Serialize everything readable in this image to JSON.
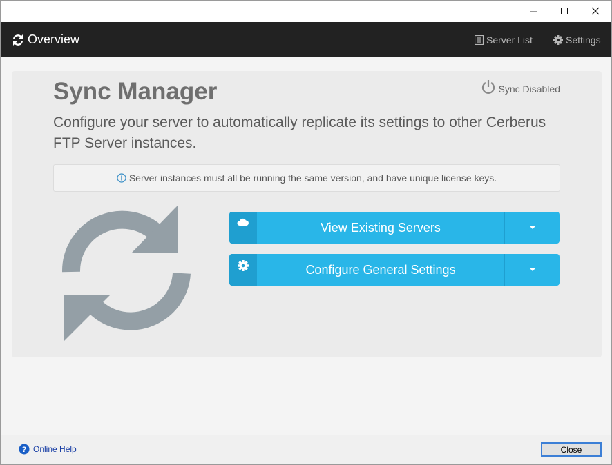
{
  "window": {
    "controls": [
      "minimize-icon",
      "maximize-icon",
      "close-icon"
    ]
  },
  "navbar": {
    "brand_label": "Overview",
    "brand_icon": "refresh-icon",
    "server_list_label": "Server List",
    "server_list_icon": "list-icon",
    "settings_label": "Settings",
    "settings_icon": "gear-icon"
  },
  "main": {
    "title": "Sync Manager",
    "sync_status_label": "Sync Disabled",
    "sync_status_icon": "power-icon",
    "description": "Configure your server to automatically replicate its settings to other Cerberus FTP Server instances.",
    "info_text": "Server instances must all be running the same version, and have unique license keys.",
    "info_icon": "info-circle-icon",
    "hero_icon": "sync-icon",
    "buttons": [
      {
        "label": "View Existing Servers",
        "icon": "cloud-icon"
      },
      {
        "label": "Configure General Settings",
        "icon": "gear-icon"
      }
    ]
  },
  "footer": {
    "help_label": "Online Help",
    "help_icon": "question-circle-icon",
    "close_label": "Close"
  },
  "colors": {
    "navbar_bg": "#222222",
    "button_bg": "#29b6e8",
    "button_icon_bg": "#1f9fd0",
    "hero_icon": "#949fa6",
    "panel_bg": "#ebebeb"
  }
}
